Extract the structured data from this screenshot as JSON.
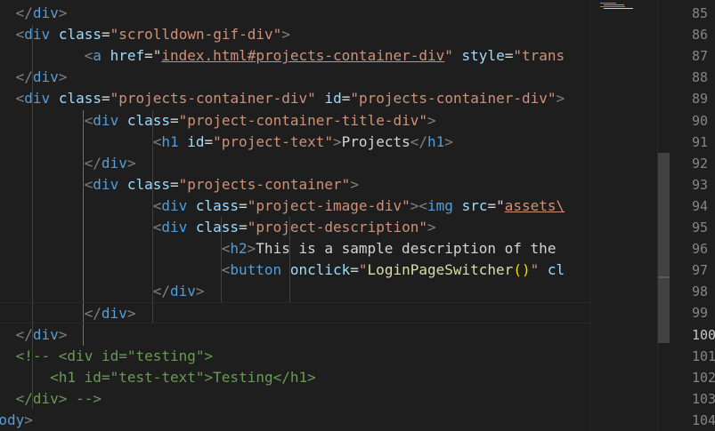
{
  "editor": {
    "lines": [
      {
        "indent": 1,
        "tokens": [
          {
            "t": "</",
            "c": "p"
          },
          {
            "t": "div",
            "c": "tag"
          },
          {
            "t": ">",
            "c": "p"
          }
        ]
      },
      {
        "indent": 1,
        "tokens": [
          {
            "t": "<",
            "c": "p"
          },
          {
            "t": "div",
            "c": "tag"
          },
          {
            "t": " "
          },
          {
            "t": "class",
            "c": "attr"
          },
          {
            "t": "="
          },
          {
            "t": "\"scrolldown-gif-div\"",
            "c": "str"
          },
          {
            "t": ">",
            "c": "p"
          }
        ]
      },
      {
        "indent": 5,
        "tokens": [
          {
            "t": "<",
            "c": "p"
          },
          {
            "t": "a",
            "c": "tag"
          },
          {
            "t": " "
          },
          {
            "t": "href",
            "c": "attr"
          },
          {
            "t": "=\""
          },
          {
            "t": "index.html#projects-container-div",
            "c": "stru"
          },
          {
            "t": "\" ",
            "c": "str"
          },
          {
            "t": "style",
            "c": "attr"
          },
          {
            "t": "="
          },
          {
            "t": "\"trans",
            "c": "str"
          }
        ]
      },
      {
        "indent": 1,
        "tokens": [
          {
            "t": "</",
            "c": "p"
          },
          {
            "t": "div",
            "c": "tag"
          },
          {
            "t": ">",
            "c": "p"
          }
        ]
      },
      {
        "indent": 1,
        "tokens": [
          {
            "t": "<",
            "c": "p"
          },
          {
            "t": "div",
            "c": "tag"
          },
          {
            "t": " "
          },
          {
            "t": "class",
            "c": "attr"
          },
          {
            "t": "="
          },
          {
            "t": "\"projects-container-div\"",
            "c": "str"
          },
          {
            "t": " "
          },
          {
            "t": "id",
            "c": "attr"
          },
          {
            "t": "="
          },
          {
            "t": "\"projects-container-div\"",
            "c": "str"
          },
          {
            "t": ">",
            "c": "p"
          }
        ]
      },
      {
        "indent": 5,
        "tokens": [
          {
            "t": "<",
            "c": "p"
          },
          {
            "t": "div",
            "c": "tag"
          },
          {
            "t": " "
          },
          {
            "t": "class",
            "c": "attr"
          },
          {
            "t": "="
          },
          {
            "t": "\"project-container-title-div\"",
            "c": "str"
          },
          {
            "t": ">",
            "c": "p"
          }
        ]
      },
      {
        "indent": 9,
        "tokens": [
          {
            "t": "<",
            "c": "p"
          },
          {
            "t": "h1",
            "c": "tag"
          },
          {
            "t": " "
          },
          {
            "t": "id",
            "c": "attr"
          },
          {
            "t": "="
          },
          {
            "t": "\"project-text\"",
            "c": "str"
          },
          {
            "t": ">",
            "c": "p"
          },
          {
            "t": "Projects",
            "c": "text"
          },
          {
            "t": "</",
            "c": "p"
          },
          {
            "t": "h1",
            "c": "tag"
          },
          {
            "t": ">",
            "c": "p"
          }
        ]
      },
      {
        "indent": 5,
        "tokens": [
          {
            "t": "</",
            "c": "p"
          },
          {
            "t": "div",
            "c": "tag"
          },
          {
            "t": ">",
            "c": "p"
          }
        ]
      },
      {
        "indent": 5,
        "tokens": [
          {
            "t": "<",
            "c": "p"
          },
          {
            "t": "div",
            "c": "tag"
          },
          {
            "t": " "
          },
          {
            "t": "class",
            "c": "attr"
          },
          {
            "t": "="
          },
          {
            "t": "\"projects-container\"",
            "c": "str"
          },
          {
            "t": ">",
            "c": "p"
          }
        ]
      },
      {
        "indent": 9,
        "tokens": [
          {
            "t": "<",
            "c": "p"
          },
          {
            "t": "div",
            "c": "tag"
          },
          {
            "t": " "
          },
          {
            "t": "class",
            "c": "attr"
          },
          {
            "t": "="
          },
          {
            "t": "\"project-image-div\"",
            "c": "str"
          },
          {
            "t": ">",
            "c": "p"
          },
          {
            "t": "<",
            "c": "p"
          },
          {
            "t": "img",
            "c": "tag"
          },
          {
            "t": " "
          },
          {
            "t": "src",
            "c": "attr"
          },
          {
            "t": "=\""
          },
          {
            "t": "assets\\",
            "c": "stru"
          }
        ]
      },
      {
        "indent": 9,
        "tokens": [
          {
            "t": "<",
            "c": "p"
          },
          {
            "t": "div",
            "c": "tag"
          },
          {
            "t": " "
          },
          {
            "t": "class",
            "c": "attr"
          },
          {
            "t": "="
          },
          {
            "t": "\"project-description\"",
            "c": "str"
          },
          {
            "t": ">",
            "c": "p"
          }
        ]
      },
      {
        "indent": 13,
        "tokens": [
          {
            "t": "<",
            "c": "p"
          },
          {
            "t": "h2",
            "c": "tag"
          },
          {
            "t": ">",
            "c": "p"
          },
          {
            "t": "This is a sample description of the",
            "c": "text"
          }
        ]
      },
      {
        "indent": 13,
        "tokens": [
          {
            "t": "<",
            "c": "p"
          },
          {
            "t": "button",
            "c": "tag"
          },
          {
            "t": " "
          },
          {
            "t": "onclick",
            "c": "attr"
          },
          {
            "t": "="
          },
          {
            "t": "\"",
            "c": "str"
          },
          {
            "t": "LoginPageSwitcher",
            "c": "fn"
          },
          {
            "t": "()",
            "c": "paren"
          },
          {
            "t": "\"",
            "c": "str"
          },
          {
            "t": " "
          },
          {
            "t": "cl",
            "c": "attr"
          }
        ]
      },
      {
        "indent": 9,
        "tokens": [
          {
            "t": "</",
            "c": "p"
          },
          {
            "t": "div",
            "c": "tag"
          },
          {
            "t": ">",
            "c": "p"
          }
        ]
      },
      {
        "indent": 5,
        "tokens": [
          {
            "t": "</",
            "c": "p"
          },
          {
            "t": "div",
            "c": "tag"
          },
          {
            "t": ">",
            "c": "p"
          }
        ],
        "current": true
      },
      {
        "indent": 1,
        "tokens": [
          {
            "t": "</",
            "c": "p"
          },
          {
            "t": "div",
            "c": "tag"
          },
          {
            "t": ">",
            "c": "p"
          }
        ]
      },
      {
        "indent": 1,
        "tokens": [
          {
            "t": "<!-- <div id=\"testing\">",
            "c": "com"
          }
        ]
      },
      {
        "indent": 3,
        "tokens": [
          {
            "t": "<h1 id=\"test-text\">Testing</h1>",
            "c": "com"
          }
        ]
      },
      {
        "indent": 1,
        "tokens": [
          {
            "t": "</div> -->",
            "c": "com"
          }
        ]
      },
      {
        "indent": -1,
        "tokens": [
          {
            "t": "/",
            "c": "p"
          },
          {
            "t": "body",
            "c": "tag"
          },
          {
            "t": ">",
            "c": "p"
          }
        ]
      }
    ]
  },
  "gutter": {
    "line_numbers": [
      "85",
      "86",
      "87",
      "88",
      "89",
      "90",
      "91",
      "92",
      "93",
      "94",
      "95",
      "96",
      "97",
      "98",
      "99",
      "100",
      "101",
      "102",
      "103",
      "104"
    ],
    "active_line": "100"
  },
  "colors": {
    "background": "#1e1e1e",
    "tag": "#569cd6",
    "attribute": "#9cdcfe",
    "string": "#ce9178",
    "comment": "#6a9955",
    "function": "#dcdcaa",
    "punctuation": "#808080",
    "line_number": "#858585",
    "scrollbar_thumb": "#424242"
  }
}
